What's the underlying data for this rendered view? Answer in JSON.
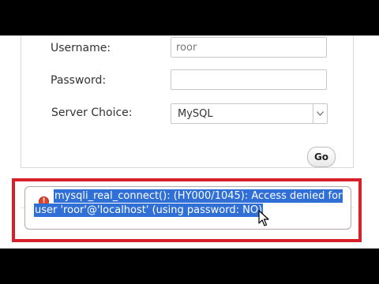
{
  "login_form": {
    "username_label": "Username:",
    "username_value": "roor",
    "password_label": "Password:",
    "password_value": "",
    "server_label": "Server Choice:",
    "server_value": "MySQL",
    "go_label": "Go"
  },
  "error": {
    "line1": "mysqli_real_connect(): (HY000/1045): Access denied for",
    "line2": "user 'roor'@'localhost' (using password: NO)",
    "icon": "error-icon",
    "highlight_color": "#2f6fd6",
    "frame_color": "#d6202a"
  }
}
